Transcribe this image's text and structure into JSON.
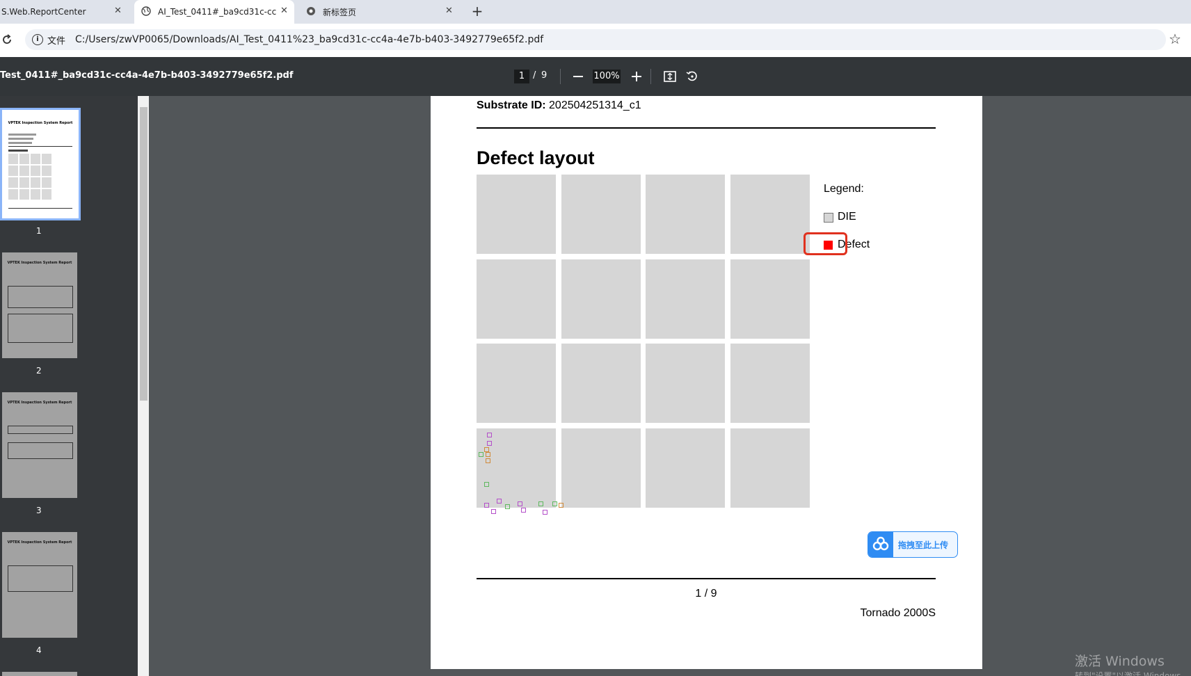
{
  "tabs": [
    {
      "title": "S.Web.ReportCenter",
      "active": false
    },
    {
      "title": "AI_Test_0411#_ba9cd31c-cc4",
      "active": true
    },
    {
      "title": "新标签页",
      "active": false
    }
  ],
  "address": {
    "scheme_label": "文件",
    "url": "C:/Users/zwVP0065/Downloads/AI_Test_0411%23_ba9cd31c-cc4a-4e7b-b403-3492779e65f2.pdf"
  },
  "pdf_toolbar": {
    "file_name": "Test_0411#_ba9cd31c-cc4a-4e7b-b403-3492779e65f2.pdf",
    "current_page": "1",
    "separator": "/",
    "total_pages": "9",
    "zoom": "100%"
  },
  "thumbnails": [
    {
      "label": "1",
      "title": "VPTEK Inspection System Report",
      "selected": true
    },
    {
      "label": "2",
      "title": "VPTEK Inspection System Report",
      "selected": false
    },
    {
      "label": "3",
      "title": "VPTEK Inspection System Report",
      "selected": false
    },
    {
      "label": "4",
      "title": "VPTEK Inspection System Report",
      "selected": false
    }
  ],
  "page": {
    "substrate_label": "Substrate ID:",
    "substrate_value": "202504251314_c1",
    "section_title": "Defect layout",
    "legend_title": "Legend:",
    "legend_die": "DIE",
    "legend_defect": "Defect",
    "page_number": "1 / 9",
    "footer_text": "Tornado 2000S"
  },
  "upload_widget": {
    "label": "拖拽至此上传"
  },
  "watermark": {
    "line1": "激活 Windows",
    "line2": "转到\"设置\"以激活 Windows。"
  },
  "colors": {
    "die": "#d6d6d6",
    "defect": "#ff0000",
    "highlight": "#e0311e",
    "upload_accent": "#2f8cf3"
  }
}
